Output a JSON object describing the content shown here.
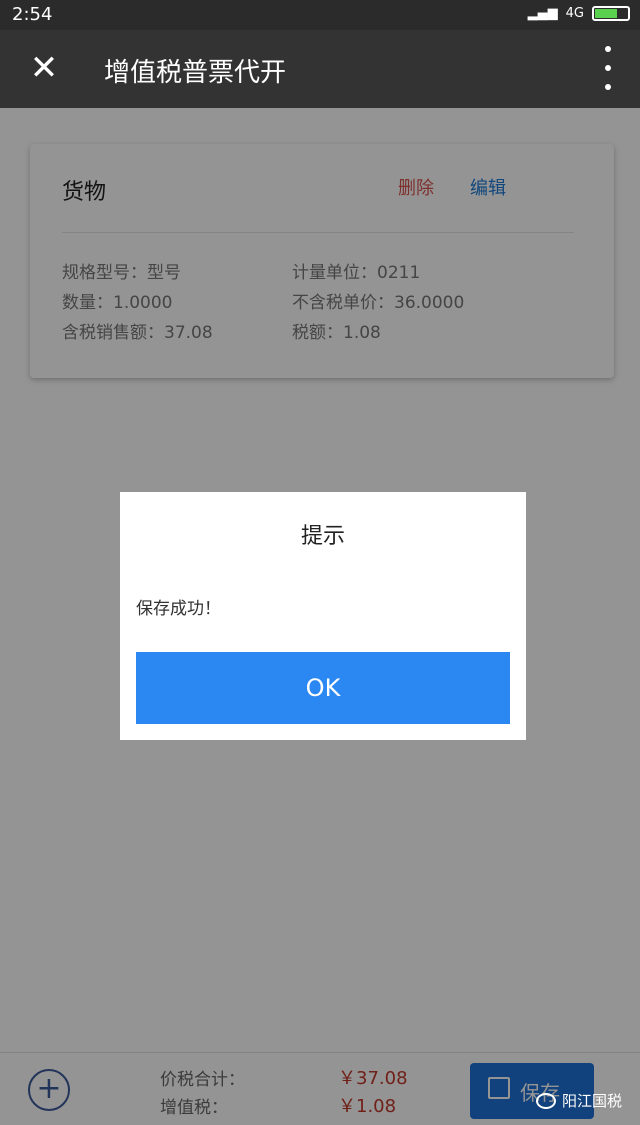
{
  "status_bar": {
    "time": "2:54",
    "network": "4G"
  },
  "app_bar": {
    "title": "增值税普票代开"
  },
  "goods_card": {
    "name": "货物",
    "delete_label": "删除",
    "edit_label": "编辑",
    "fields": {
      "spec": "规格型号：型号",
      "unit": "计量单位：0211",
      "quantity": "数量：1.0000",
      "unit_price": "不含税单价：36.0000",
      "amount_with_tax": "含税销售额：37.08",
      "tax": "税额：1.08"
    }
  },
  "bottom_bar": {
    "total_label": "价税合计：",
    "total_value": "￥37.08",
    "vat_label": "增值税：",
    "vat_value": "￥1.08",
    "save_label": "保存"
  },
  "watermark": {
    "text": "阳江国税"
  },
  "dialog": {
    "title": "提示",
    "message": "保存成功！",
    "ok_label": "OK"
  },
  "colors": {
    "delete": "#d9534f",
    "edit": "#1e7bd6",
    "ok_button": "#2b88f2",
    "amount": "#c0392b"
  }
}
